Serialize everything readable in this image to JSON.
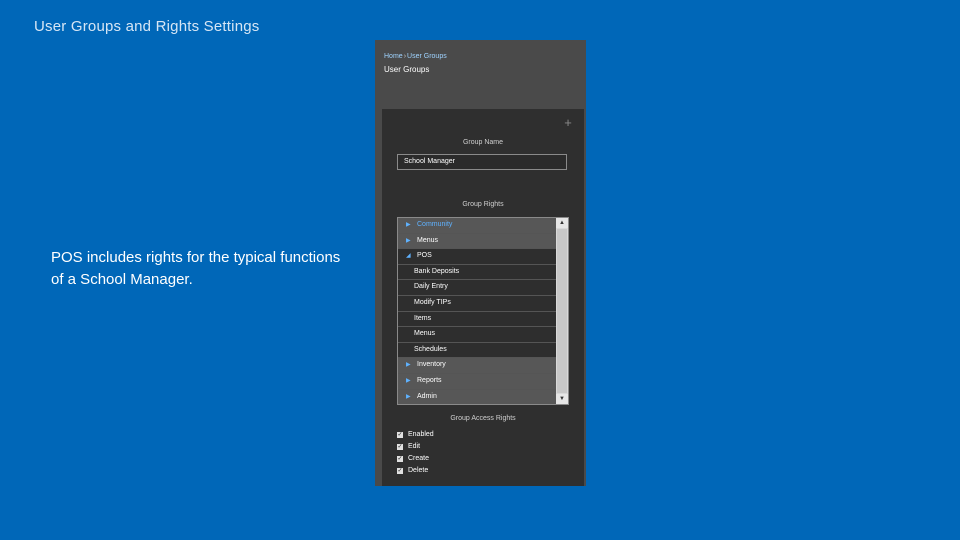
{
  "slide": {
    "title": "User Groups and Rights Settings",
    "body": "POS includes rights for the typical functions of a School Manager."
  },
  "app": {
    "breadcrumb": {
      "home": "Home",
      "separator": "›",
      "current": "User Groups"
    },
    "page_title": "User Groups",
    "add_icon": "plus-icon",
    "group_name_label": "Group Name",
    "group_name_value": "School Manager",
    "group_rights_label": "Group Rights",
    "rights": [
      {
        "label": "Community",
        "level": 0,
        "expanded": false,
        "highlight": true
      },
      {
        "label": "Menus",
        "level": 0,
        "expanded": false,
        "highlight": false
      },
      {
        "label": "POS",
        "level": 0,
        "expanded": true,
        "highlight": false
      },
      {
        "label": "Bank Deposits",
        "level": 1
      },
      {
        "label": "Daily Entry",
        "level": 1
      },
      {
        "label": "Modify TIPs",
        "level": 1
      },
      {
        "label": "Items",
        "level": 1
      },
      {
        "label": "Menus",
        "level": 1
      },
      {
        "label": "Schedules",
        "level": 1
      },
      {
        "label": "Inventory",
        "level": 0,
        "expanded": false,
        "highlight": false
      },
      {
        "label": "Reports",
        "level": 0,
        "expanded": false,
        "highlight": false
      },
      {
        "label": "Admin",
        "level": 0,
        "expanded": false,
        "highlight": false
      }
    ],
    "access_rights_label": "Group Access Rights",
    "access_rights": [
      {
        "label": "Enabled",
        "checked": true
      },
      {
        "label": "Edit",
        "checked": true
      },
      {
        "label": "Create",
        "checked": true
      },
      {
        "label": "Delete",
        "checked": true
      }
    ]
  },
  "colors": {
    "background": "#0067b8",
    "accent": "#5fb2ff",
    "panel": "#2f2f2f"
  }
}
